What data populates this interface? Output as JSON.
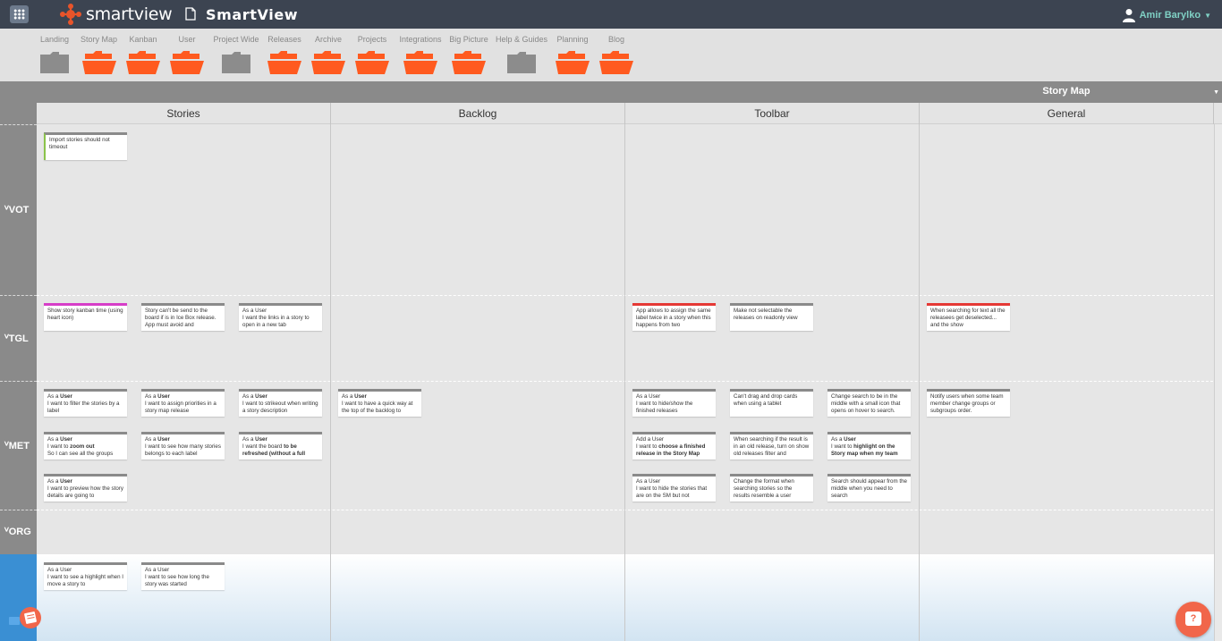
{
  "topbar": {
    "logo_text": "smartview",
    "app_title": "SmartView",
    "user_name": "Amir Barylko",
    "icons": [
      "grid-icon",
      "logo-icon",
      "document-icon",
      "user-icon",
      "caret-down-icon"
    ]
  },
  "folders": [
    {
      "label": "Landing",
      "color": "grey"
    },
    {
      "label": "Story Map",
      "color": "orange"
    },
    {
      "label": "Kanban",
      "color": "orange"
    },
    {
      "label": "User",
      "color": "orange"
    },
    {
      "label": "Project Wide",
      "color": "grey"
    },
    {
      "label": "Releases",
      "color": "orange"
    },
    {
      "label": "Archive",
      "color": "orange"
    },
    {
      "label": "Projects",
      "color": "orange"
    },
    {
      "label": "Integrations",
      "color": "orange"
    },
    {
      "label": "Big Picture",
      "color": "orange"
    },
    {
      "label": "Help & Guides",
      "color": "grey"
    },
    {
      "label": "Planning",
      "color": "orange"
    },
    {
      "label": "Blog",
      "color": "orange"
    }
  ],
  "colors": {
    "orange": "#ff5a1f",
    "grey": "#8c8c8c",
    "topbar": "#3c4451",
    "accent": "#7fd0c4"
  },
  "board": {
    "title": "Story Map",
    "columns": [
      "Stories",
      "Backlog",
      "Toolbar",
      "General"
    ],
    "rows": [
      {
        "label": "ⱽVOT"
      },
      {
        "label": "ⱽTGL"
      },
      {
        "label": "ⱽMET"
      },
      {
        "label": "ⱽORG"
      }
    ]
  },
  "cards": {
    "c1": "Import stories should not timeout",
    "c2": "Show story kanban time (using heart icon)",
    "c3": "Story can't be send to the board if is in Ice Box release. App must avoid and",
    "c4a": "As a User",
    "c4b": "I want the links in a story to open in a new tab",
    "c5": "App allows to assign the same label twice in a story when this happens from two",
    "c6": "Make not selectable the releases on readonly view",
    "c7": "When searching for text all the releasees get deselected... and the show",
    "m1a": "As a ",
    "m1b": "User",
    "m1c": "I want to filter the stories by a label",
    "m2a": "As a ",
    "m2b": "User",
    "m2c": "I want to assign priorities in a story map release",
    "m3a": "As a ",
    "m3b": "User",
    "m3c": "I want to strikeout when writing a story description",
    "m4a": "As a ",
    "m4b": "User",
    "m4c": "I want to have a quick way at the top of the backlog to",
    "m5a": "As a User",
    "m5b": "I want to hide/show the finished releases",
    "m6": "Can't drag and drop cards when using a tablet",
    "m7": "Change search to be in the middle with a small icon that opens on hover to search.",
    "m8": "Notify users when some team member change groups or subgroups order.",
    "m9a": "As a ",
    "m9b": "User",
    "m9c": "I want to ",
    "m9d": "zoom out",
    "m9e": "So I can see all the groups",
    "m10a": "As a ",
    "m10b": "User",
    "m10c": "I want to see how many stories belongs to each label",
    "m11a": "As a ",
    "m11b": "User",
    "m11c": "I want the board ",
    "m11d": "to be refreshed (without a full",
    "m12a": "Add a User",
    "m12b": "I want to ",
    "m12c": "choose a finished release in the Story Map",
    "m13": "When searching if the result is in an old release, turn on show old releases filter and",
    "m14a": "As a ",
    "m14b": "User",
    "m14c": "I want to ",
    "m14d": "highlight on the Story map when my team",
    "m15a": "As a ",
    "m15b": "User",
    "m15c": "I want to preview how the story details are going to",
    "m16a": "As a User",
    "m16b": "I want to hide the stories that are on the SM but not",
    "m17": "Change the format when searching stories so the results resemble a user",
    "m18": "Search should appear from the middle when you need to search",
    "b1a": "As a User",
    "b1b": "I want to see a highlight when I move a story to",
    "b2a": "As a User",
    "b2b": "I want to see how long the story was started"
  }
}
